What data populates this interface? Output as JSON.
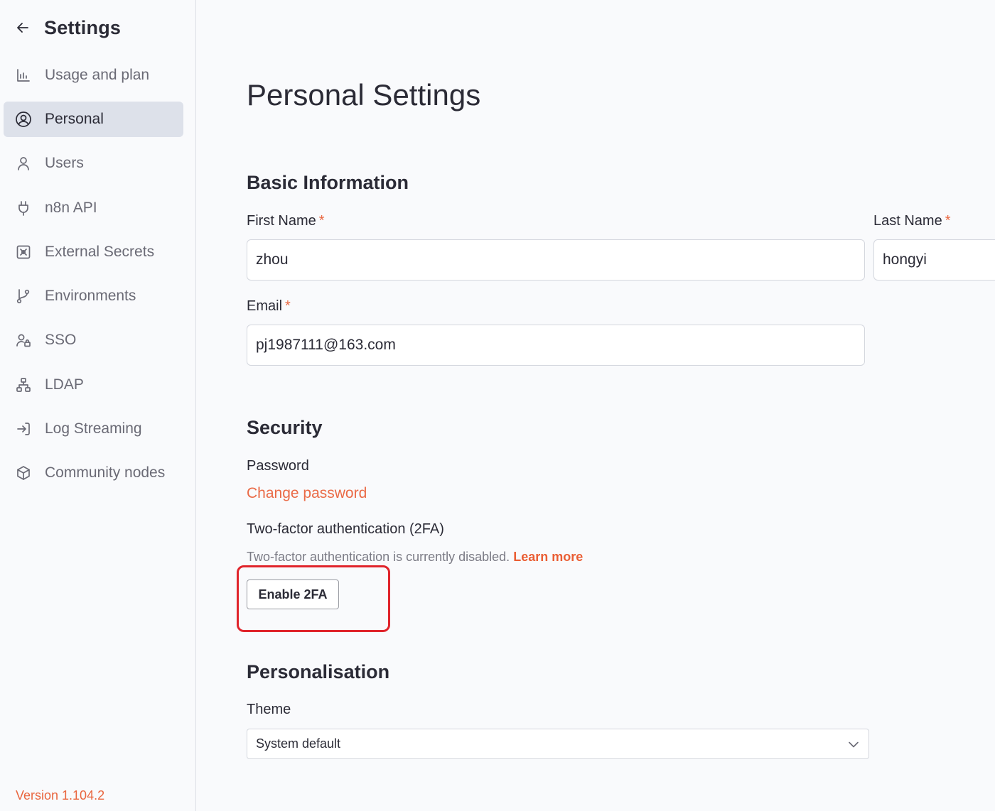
{
  "sidebar": {
    "title": "Settings",
    "items": [
      {
        "label": "Usage and plan",
        "icon": "bar-chart-icon"
      },
      {
        "label": "Personal",
        "icon": "user-circle-icon",
        "active": true
      },
      {
        "label": "Users",
        "icon": "user-icon"
      },
      {
        "label": "n8n API",
        "icon": "plug-icon"
      },
      {
        "label": "External Secrets",
        "icon": "vault-icon"
      },
      {
        "label": "Environments",
        "icon": "git-branch-icon"
      },
      {
        "label": "SSO",
        "icon": "user-lock-icon"
      },
      {
        "label": "LDAP",
        "icon": "network-icon"
      },
      {
        "label": "Log Streaming",
        "icon": "sign-in-icon"
      },
      {
        "label": "Community nodes",
        "icon": "cube-icon"
      }
    ],
    "version": "Version 1.104.2"
  },
  "main": {
    "page_title": "Personal Settings",
    "basic": {
      "title": "Basic Information",
      "first_name_label": "First Name",
      "first_name_value": "zhou",
      "last_name_label": "Last Name",
      "last_name_value": "hongyi",
      "email_label": "Email",
      "email_value": "pj1987111@163.com",
      "required_mark": "*"
    },
    "security": {
      "title": "Security",
      "password_label": "Password",
      "change_password": "Change password",
      "twofa_label": "Two-factor authentication (2FA)",
      "twofa_desc": "Two-factor authentication is currently disabled.",
      "learn_more": "Learn more",
      "enable_button": "Enable 2FA"
    },
    "personalisation": {
      "title": "Personalisation",
      "theme_label": "Theme",
      "theme_value": "System default"
    }
  },
  "colors": {
    "accent": "#ea6a46",
    "highlight": "#e0242b",
    "active_bg": "#dde1ea"
  }
}
